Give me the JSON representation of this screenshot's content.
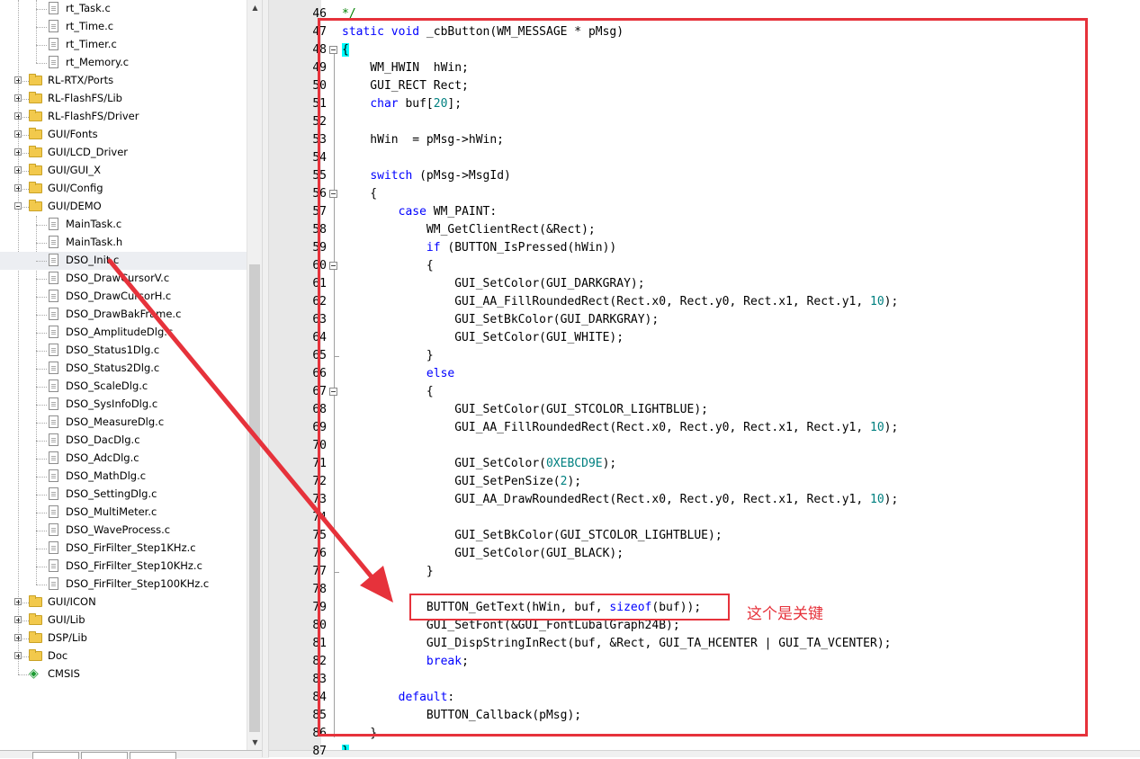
{
  "tree": {
    "rows": [
      {
        "label": "rt_Task.c",
        "type": "file",
        "level": 2
      },
      {
        "label": "rt_Time.c",
        "type": "file",
        "level": 2
      },
      {
        "label": "rt_Timer.c",
        "type": "file",
        "level": 2
      },
      {
        "label": "rt_Memory.c",
        "type": "file",
        "level": 2
      },
      {
        "label": "RL-RTX/Ports",
        "type": "folder",
        "level": 1,
        "expanded": false
      },
      {
        "label": "RL-FlashFS/Lib",
        "type": "folder",
        "level": 1,
        "expanded": false
      },
      {
        "label": "RL-FlashFS/Driver",
        "type": "folder",
        "level": 1,
        "expanded": false
      },
      {
        "label": "GUI/Fonts",
        "type": "folder",
        "level": 1,
        "expanded": false
      },
      {
        "label": "GUI/LCD_Driver",
        "type": "folder",
        "level": 1,
        "expanded": false
      },
      {
        "label": "GUI/GUI_X",
        "type": "folder",
        "level": 1,
        "expanded": false
      },
      {
        "label": "GUI/Config",
        "type": "folder",
        "level": 1,
        "expanded": false
      },
      {
        "label": "GUI/DEMO",
        "type": "folder",
        "level": 1,
        "expanded": true
      },
      {
        "label": "MainTask.c",
        "type": "file",
        "level": 2
      },
      {
        "label": "MainTask.h",
        "type": "file",
        "level": 2
      },
      {
        "label": "DSO_Init.c",
        "type": "file",
        "level": 2,
        "selected": true
      },
      {
        "label": "DSO_DrawCursorV.c",
        "type": "file",
        "level": 2
      },
      {
        "label": "DSO_DrawCursorH.c",
        "type": "file",
        "level": 2
      },
      {
        "label": "DSO_DrawBakFrame.c",
        "type": "file",
        "level": 2
      },
      {
        "label": "DSO_AmplitudeDlg.c",
        "type": "file",
        "level": 2
      },
      {
        "label": "DSO_Status1Dlg.c",
        "type": "file",
        "level": 2
      },
      {
        "label": "DSO_Status2Dlg.c",
        "type": "file",
        "level": 2
      },
      {
        "label": "DSO_ScaleDlg.c",
        "type": "file",
        "level": 2
      },
      {
        "label": "DSO_SysInfoDlg.c",
        "type": "file",
        "level": 2
      },
      {
        "label": "DSO_MeasureDlg.c",
        "type": "file",
        "level": 2
      },
      {
        "label": "DSO_DacDlg.c",
        "type": "file",
        "level": 2
      },
      {
        "label": "DSO_AdcDlg.c",
        "type": "file",
        "level": 2
      },
      {
        "label": "DSO_MathDlg.c",
        "type": "file",
        "level": 2
      },
      {
        "label": "DSO_SettingDlg.c",
        "type": "file",
        "level": 2
      },
      {
        "label": "DSO_MultiMeter.c",
        "type": "file",
        "level": 2
      },
      {
        "label": "DSO_WaveProcess.c",
        "type": "file",
        "level": 2
      },
      {
        "label": "DSO_FirFilter_Step1KHz.c",
        "type": "file",
        "level": 2
      },
      {
        "label": "DSO_FirFilter_Step10KHz.c",
        "type": "file",
        "level": 2
      },
      {
        "label": "DSO_FirFilter_Step100KHz.c",
        "type": "file",
        "level": 2
      },
      {
        "label": "GUI/ICON",
        "type": "folder",
        "level": 1,
        "expanded": false
      },
      {
        "label": "GUI/Lib",
        "type": "folder",
        "level": 1,
        "expanded": false
      },
      {
        "label": "DSP/Lib",
        "type": "folder",
        "level": 1,
        "expanded": false
      },
      {
        "label": "Doc",
        "type": "folder",
        "level": 1,
        "expanded": false
      },
      {
        "label": "CMSIS",
        "type": "package",
        "level": 1
      }
    ]
  },
  "editor": {
    "lines": [
      {
        "num": "46",
        "tokens": [
          [
            "c",
            "*/"
          ]
        ]
      },
      {
        "num": "47",
        "tokens": [
          [
            "k",
            "static"
          ],
          [
            "t",
            " "
          ],
          [
            "k",
            "void"
          ],
          [
            "t",
            " _cbButton(WM_MESSAGE * pMsg)"
          ]
        ]
      },
      {
        "num": "48",
        "fold": "start",
        "tokens": [
          [
            "h",
            "{"
          ]
        ]
      },
      {
        "num": "49",
        "tokens": [
          [
            "t",
            "    WM_HWIN  hWin;"
          ]
        ]
      },
      {
        "num": "50",
        "tokens": [
          [
            "t",
            "    GUI_RECT Rect;"
          ]
        ]
      },
      {
        "num": "51",
        "tokens": [
          [
            "t",
            "    "
          ],
          [
            "k",
            "char"
          ],
          [
            "t",
            " buf["
          ],
          [
            "n",
            "20"
          ],
          [
            "t",
            "];"
          ]
        ]
      },
      {
        "num": "52",
        "tokens": []
      },
      {
        "num": "53",
        "tokens": [
          [
            "t",
            "    hWin  = pMsg->hWin;"
          ]
        ]
      },
      {
        "num": "54",
        "tokens": []
      },
      {
        "num": "55",
        "tokens": [
          [
            "t",
            "    "
          ],
          [
            "k",
            "switch"
          ],
          [
            "t",
            " (pMsg->MsgId)"
          ]
        ]
      },
      {
        "num": "56",
        "fold": "start",
        "tokens": [
          [
            "t",
            "    {"
          ]
        ]
      },
      {
        "num": "57",
        "tokens": [
          [
            "t",
            "        "
          ],
          [
            "k",
            "case"
          ],
          [
            "t",
            " WM_PAINT:"
          ]
        ]
      },
      {
        "num": "58",
        "tokens": [
          [
            "t",
            "            WM_GetClientRect(&Rect);"
          ]
        ]
      },
      {
        "num": "59",
        "tokens": [
          [
            "t",
            "            "
          ],
          [
            "k",
            "if"
          ],
          [
            "t",
            " (BUTTON_IsPressed(hWin))"
          ]
        ]
      },
      {
        "num": "60",
        "fold": "start",
        "tokens": [
          [
            "t",
            "            {"
          ]
        ]
      },
      {
        "num": "61",
        "tokens": [
          [
            "t",
            "                GUI_SetColor(GUI_DARKGRAY);"
          ]
        ]
      },
      {
        "num": "62",
        "tokens": [
          [
            "t",
            "                GUI_AA_FillRoundedRect(Rect.x0, Rect.y0, Rect.x1, Rect.y1, "
          ],
          [
            "n",
            "10"
          ],
          [
            "t",
            ");"
          ]
        ]
      },
      {
        "num": "63",
        "tokens": [
          [
            "t",
            "                GUI_SetBkColor(GUI_DARKGRAY);"
          ]
        ]
      },
      {
        "num": "64",
        "tokens": [
          [
            "t",
            "                GUI_SetColor(GUI_WHITE);"
          ]
        ]
      },
      {
        "num": "65",
        "fold": "end",
        "tokens": [
          [
            "t",
            "            }"
          ]
        ]
      },
      {
        "num": "66",
        "tokens": [
          [
            "t",
            "            "
          ],
          [
            "k",
            "else"
          ]
        ]
      },
      {
        "num": "67",
        "fold": "start",
        "tokens": [
          [
            "t",
            "            {"
          ]
        ]
      },
      {
        "num": "68",
        "tokens": [
          [
            "t",
            "                GUI_SetColor(GUI_STCOLOR_LIGHTBLUE);"
          ]
        ]
      },
      {
        "num": "69",
        "tokens": [
          [
            "t",
            "                GUI_AA_FillRoundedRect(Rect.x0, Rect.y0, Rect.x1, Rect.y1, "
          ],
          [
            "n",
            "10"
          ],
          [
            "t",
            ");"
          ]
        ]
      },
      {
        "num": "70",
        "tokens": []
      },
      {
        "num": "71",
        "tokens": [
          [
            "t",
            "                GUI_SetColor("
          ],
          [
            "n",
            "0XEBCD9E"
          ],
          [
            "t",
            ");"
          ]
        ]
      },
      {
        "num": "72",
        "tokens": [
          [
            "t",
            "                GUI_SetPenSize("
          ],
          [
            "n",
            "2"
          ],
          [
            "t",
            ");"
          ]
        ]
      },
      {
        "num": "73",
        "tokens": [
          [
            "t",
            "                GUI_AA_DrawRoundedRect(Rect.x0, Rect.y0, Rect.x1, Rect.y1, "
          ],
          [
            "n",
            "10"
          ],
          [
            "t",
            ");"
          ]
        ]
      },
      {
        "num": "74",
        "tokens": []
      },
      {
        "num": "75",
        "tokens": [
          [
            "t",
            "                GUI_SetBkColor(GUI_STCOLOR_LIGHTBLUE);"
          ]
        ]
      },
      {
        "num": "76",
        "tokens": [
          [
            "t",
            "                GUI_SetColor(GUI_BLACK);"
          ]
        ]
      },
      {
        "num": "77",
        "fold": "end",
        "tokens": [
          [
            "t",
            "            }"
          ]
        ]
      },
      {
        "num": "78",
        "tokens": []
      },
      {
        "num": "79",
        "tokens": [
          [
            "t",
            "            BUTTON_GetText(hWin, buf, "
          ],
          [
            "k",
            "sizeof"
          ],
          [
            "t",
            "(buf));"
          ]
        ]
      },
      {
        "num": "80",
        "tokens": [
          [
            "t",
            "            GUI_SetFont(&GUI_FontLubalGraph24B);"
          ]
        ]
      },
      {
        "num": "81",
        "tokens": [
          [
            "t",
            "            GUI_DispStringInRect(buf, &Rect, GUI_TA_HCENTER | GUI_TA_VCENTER);"
          ]
        ]
      },
      {
        "num": "82",
        "tokens": [
          [
            "t",
            "            "
          ],
          [
            "k",
            "break"
          ],
          [
            "t",
            ";"
          ]
        ]
      },
      {
        "num": "83",
        "tokens": []
      },
      {
        "num": "84",
        "tokens": [
          [
            "t",
            "        "
          ],
          [
            "k",
            "default"
          ],
          [
            "t",
            ":"
          ]
        ]
      },
      {
        "num": "85",
        "tokens": [
          [
            "t",
            "            BUTTON_Callback(pMsg);"
          ]
        ]
      },
      {
        "num": "86",
        "fold": "end",
        "tokens": [
          [
            "t",
            "    }"
          ]
        ]
      },
      {
        "num": "87",
        "tokens": [
          [
            "h",
            "}"
          ]
        ]
      }
    ]
  },
  "annotation": {
    "note": "这个是关键",
    "color": "#e6323b"
  },
  "icons": {
    "folder": "folder-icon",
    "file": "c-file-icon",
    "package": "cmsis-package-icon",
    "scroll_up": "scroll-up-arrow-icon",
    "scroll_down": "scroll-down-arrow-icon"
  },
  "colors": {
    "keyword": "#0000ff",
    "number": "#008080",
    "comment": "#008000",
    "brace_highlight": "#00ffff",
    "line_number_bg": "#e8e8e8"
  }
}
